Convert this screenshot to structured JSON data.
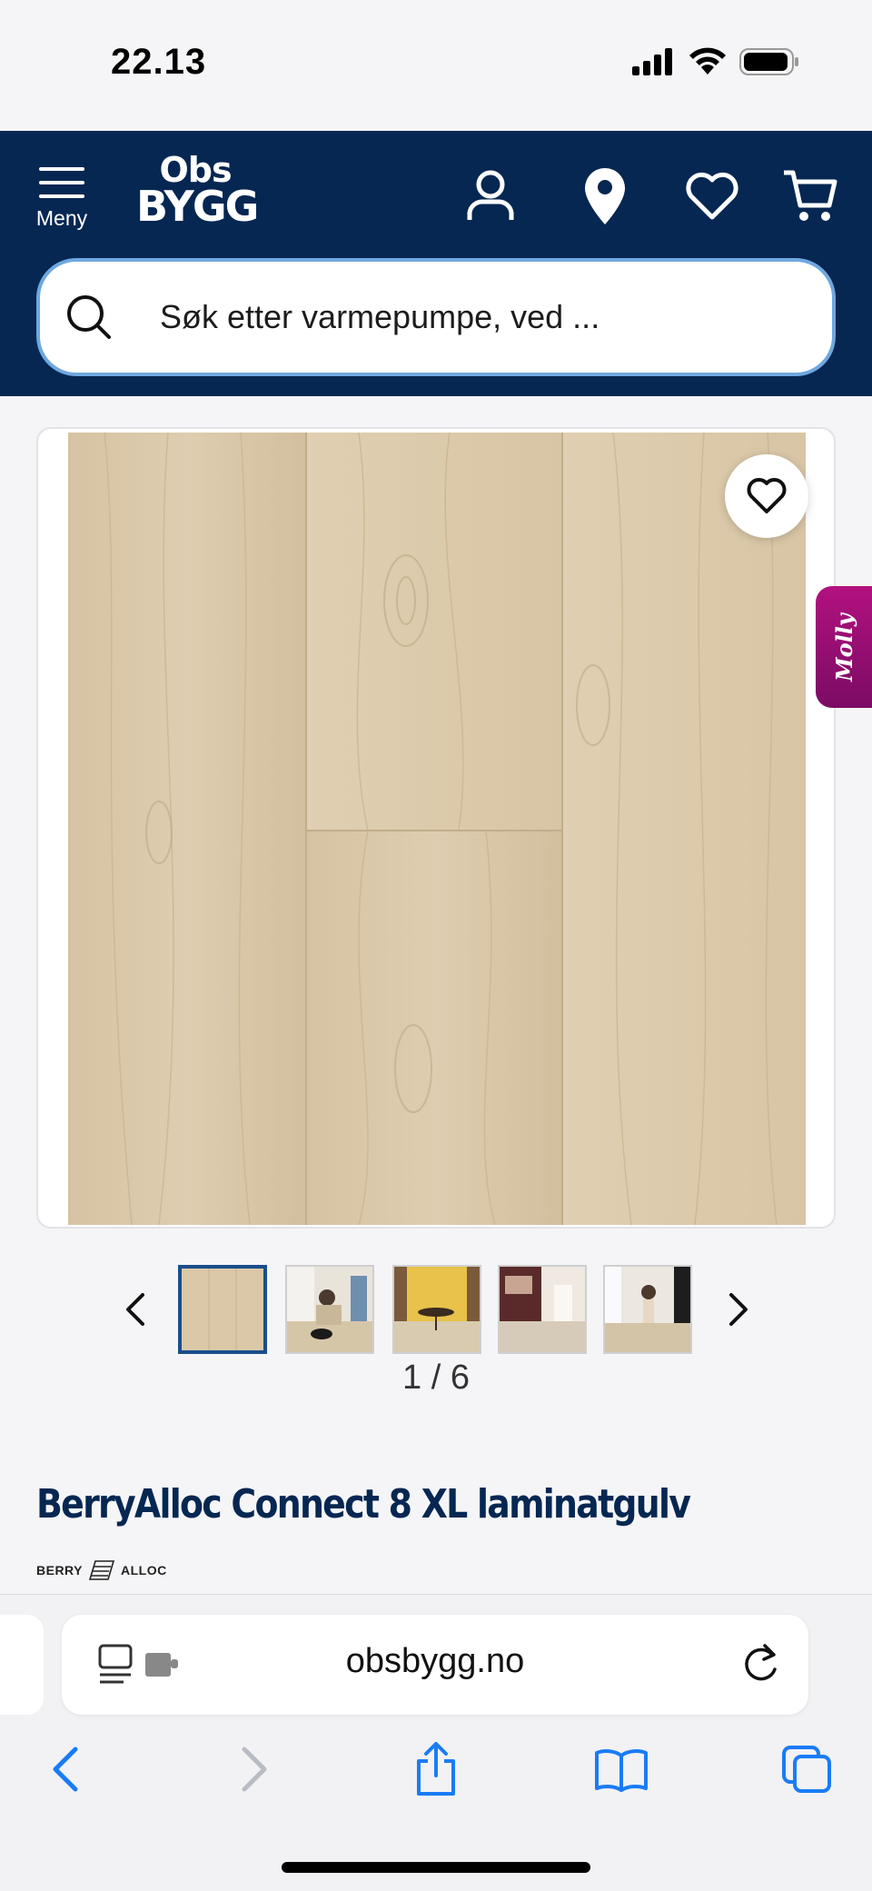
{
  "status_bar": {
    "time": "22.13"
  },
  "header": {
    "menu_label": "Meny",
    "logo_top": "Obs",
    "logo_bottom": "BYGG",
    "icons": [
      "account-icon",
      "location-icon",
      "favorites-icon",
      "cart-icon"
    ]
  },
  "search": {
    "placeholder": "Søk etter varmepumpe, ved ..."
  },
  "gallery": {
    "current": 1,
    "total": 6,
    "counter_text": "1 / 6",
    "thumbnails": 5
  },
  "chat_widget": {
    "label": "Molly"
  },
  "product": {
    "title": "BerryAlloc Connect 8 XL laminatgulv",
    "brand_left": "BERRY",
    "brand_right": "ALLOC"
  },
  "safari": {
    "url": "obsbygg.no"
  },
  "colors": {
    "brand_navy": "#062752",
    "search_border": "#6fa8e0",
    "wood": "#d9c6a6",
    "chat_magenta": "#b2117f",
    "ios_blue": "#1a7cf5"
  }
}
